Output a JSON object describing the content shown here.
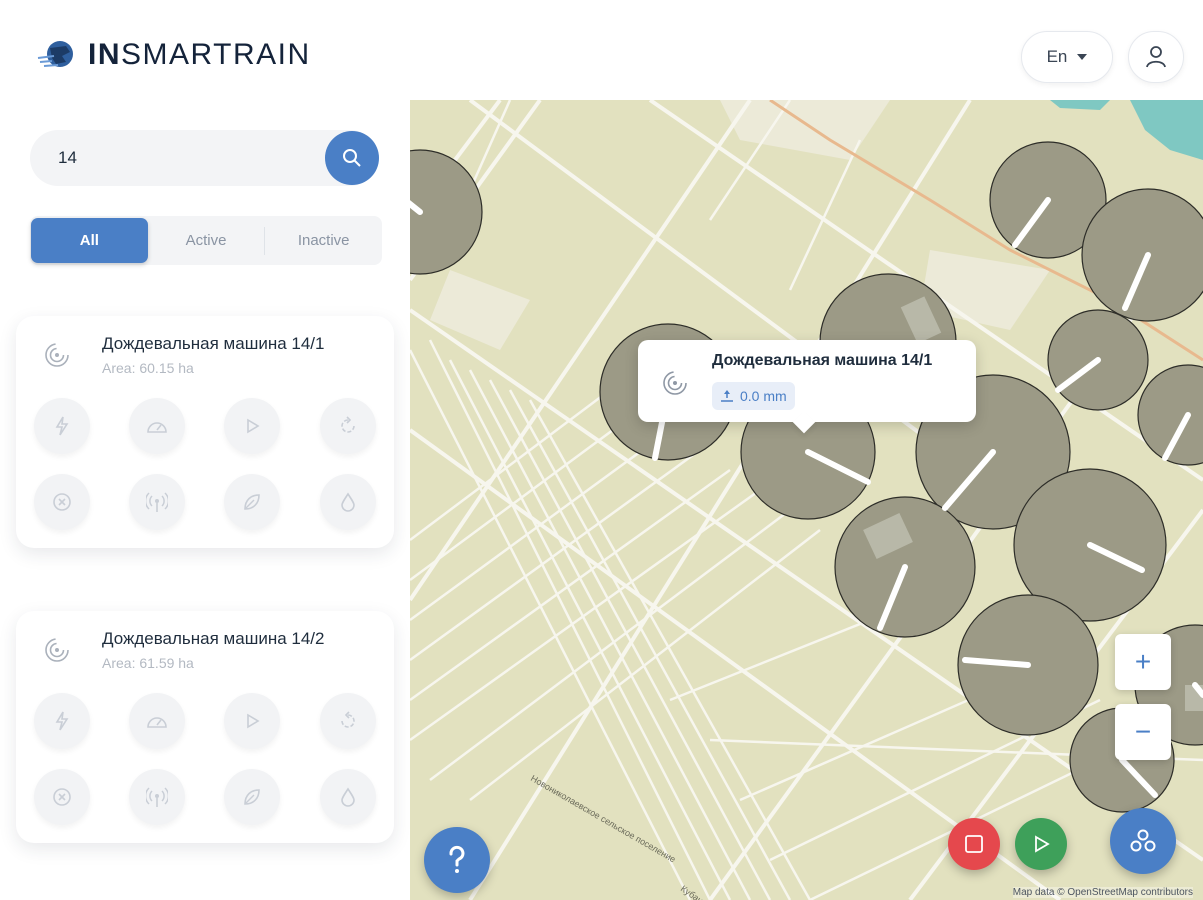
{
  "header": {
    "logo_bold": "IN",
    "logo_light": "SMARTRAIN",
    "language": "En"
  },
  "search": {
    "value": "14",
    "placeholder": ""
  },
  "tabs": [
    {
      "label": "All",
      "active": true
    },
    {
      "label": "Active",
      "active": false
    },
    {
      "label": "Inactive",
      "active": false
    }
  ],
  "machines": [
    {
      "name": "Дождевальная машина 14/1",
      "area": "Area: 60.15 ha"
    },
    {
      "name": "Дождевальная машина 14/2",
      "area": "Area: 61.59 ha"
    }
  ],
  "controls": [
    "bolt-icon",
    "speedometer-icon",
    "play-icon",
    "reverse-icon",
    "stop-circle-icon",
    "antenna-icon",
    "leaf-icon",
    "drop-icon"
  ],
  "map": {
    "popup": {
      "title": "Дождевальная машина 14/1",
      "badge": "0.0 mm"
    },
    "zoom_in": "+",
    "zoom_out": "−",
    "attribution": "Map data © OpenStreetMap contributors",
    "road_labels": [
      "Новониколаевское сельское поселение",
      "Кубанское"
    ]
  },
  "colors": {
    "accent": "#4a7fc6",
    "stop": "#e5484d",
    "start": "#3ea05a",
    "pivot": "#9c9a86",
    "map_bg": "#e2e1bf"
  }
}
